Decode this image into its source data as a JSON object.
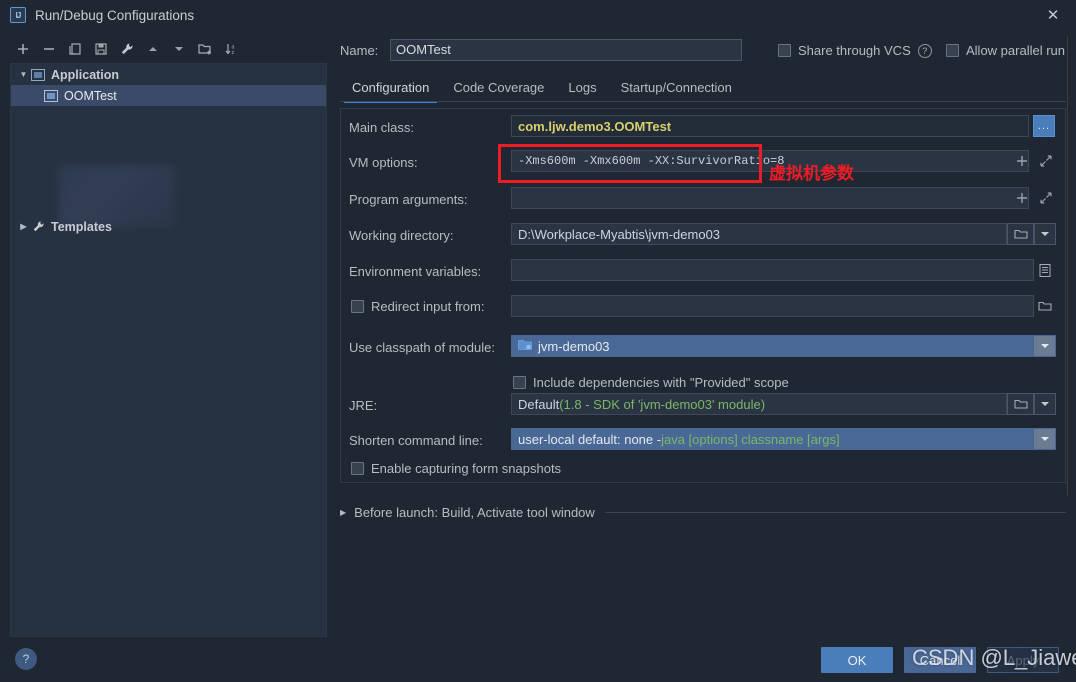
{
  "window": {
    "title": "Run/Debug Configurations",
    "app_icon": "intellij-idea-icon",
    "close_label": "✕"
  },
  "left_panel": {
    "toolbar": [
      {
        "name": "add-button",
        "icon": "plus-icon",
        "tooltip": "Add New Configuration"
      },
      {
        "name": "remove-button",
        "icon": "minus-icon",
        "tooltip": "Remove Configuration"
      },
      {
        "name": "copy-button",
        "icon": "copy-icon",
        "tooltip": "Copy Configuration"
      },
      {
        "name": "save-button",
        "icon": "save-icon",
        "tooltip": "Save Configuration"
      },
      {
        "name": "edit-templates-button",
        "icon": "wrench-icon",
        "tooltip": "Edit Templates"
      },
      {
        "name": "move-up-button",
        "icon": "arrow-up-icon",
        "tooltip": "Move Up"
      },
      {
        "name": "move-down-button",
        "icon": "arrow-down-icon",
        "tooltip": "Move Down"
      },
      {
        "name": "new-folder-button",
        "icon": "new-folder-icon",
        "tooltip": "Create New Folder"
      },
      {
        "name": "sort-button",
        "icon": "sort-alpha-icon",
        "tooltip": "Sort Configurations"
      }
    ],
    "tree": {
      "group_label": "Application",
      "group_icon": "application-icon",
      "selected_item": "OOMTest",
      "selected_item_icon": "application-icon",
      "templates_label": "Templates",
      "templates_icon": "wrench-icon"
    }
  },
  "header": {
    "name_label": "Name:",
    "name_value": "OOMTest",
    "share_vcs_label": "Share through VCS",
    "share_vcs_checked": false,
    "help_icon": "question-mark-icon",
    "allow_parallel_label": "Allow parallel run",
    "allow_parallel_checked": false
  },
  "tabs": [
    {
      "label": "Configuration",
      "active": true
    },
    {
      "label": "Code Coverage",
      "active": false
    },
    {
      "label": "Logs",
      "active": false
    },
    {
      "label": "Startup/Connection",
      "active": false
    }
  ],
  "form": {
    "main_class": {
      "label": "Main class:",
      "value": "com.ljw.demo3.OOMTest",
      "browse_label": "...",
      "browse_icon": "ellipsis-icon"
    },
    "vm_options": {
      "label": "VM options:",
      "value": "-Xms600m -Xmx600m -XX:SurvivorRatio=8",
      "add_icon": "plus-icon",
      "expand_icon": "expand-diagonal-icon"
    },
    "program_arguments": {
      "label": "Program arguments:",
      "value": "",
      "add_icon": "plus-icon",
      "expand_icon": "expand-diagonal-icon"
    },
    "working_directory": {
      "label": "Working directory:",
      "value": "D:\\Workplace-Myabtis\\jvm-demo03",
      "folder_icon": "folder-icon",
      "dropdown_icon": "chevron-down-icon"
    },
    "environment_variables": {
      "label": "Environment variables:",
      "value": "",
      "list_icon": "list-icon"
    },
    "redirect_input": {
      "label": "Redirect input from:",
      "checked": false,
      "value": "",
      "folder_icon": "folder-icon"
    },
    "use_classpath": {
      "label": "Use classpath of module:",
      "value": "jvm-demo03",
      "module_icon": "module-icon",
      "dropdown_icon": "chevron-down-icon"
    },
    "include_provided": {
      "label": "Include dependencies with \"Provided\" scope",
      "checked": false
    },
    "jre": {
      "label": "JRE:",
      "value_prefix": "Default ",
      "value_detail": "(1.8 - SDK of 'jvm-demo03' module)",
      "folder_icon": "folder-icon",
      "dropdown_icon": "chevron-down-icon"
    },
    "shorten_command_line": {
      "label": "Shorten command line:",
      "value_prefix": "user-local default: none - ",
      "value_detail": "java [options] classname [args]",
      "dropdown_icon": "chevron-down-icon"
    },
    "enable_snapshots": {
      "label": "Enable capturing form snapshots",
      "checked": false
    }
  },
  "annotation": {
    "red_text": "虚拟机参数",
    "red_color": "#ee1c24"
  },
  "before_launch": {
    "label": "Before launch: Build, Activate tool window",
    "expand_icon": "triangle-right-icon"
  },
  "footer": {
    "help_icon": "question-mark-icon",
    "ok_label": "OK",
    "cancel_label": "Cancel",
    "apply_label": "Apply"
  },
  "watermark": {
    "text": "CSDN @L_Jiawen"
  },
  "colors": {
    "accent": "#4a7ebb",
    "selection": "#3a4a68",
    "annotation_red": "#ee1c24",
    "main_class_yellow": "#d8d06a",
    "detail_green": "#7ab867"
  }
}
